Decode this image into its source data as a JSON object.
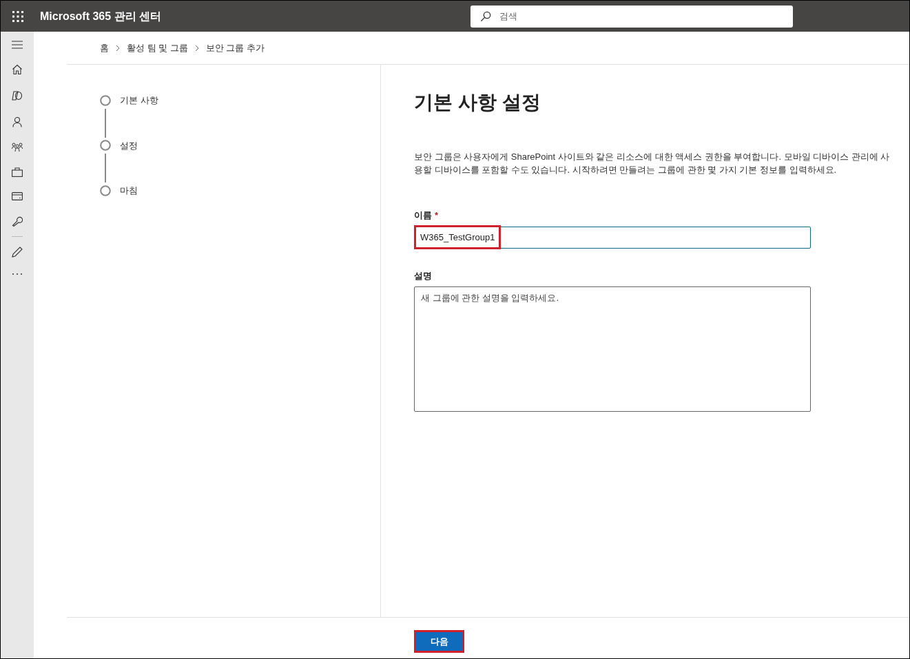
{
  "header": {
    "app_title": "Microsoft 365 관리 센터",
    "search": {
      "placeholder": "검색"
    }
  },
  "breadcrumb": [
    {
      "label": "홈"
    },
    {
      "label": "활성 팀 및 그룹"
    },
    {
      "label": "보안 그룹 추가"
    }
  ],
  "steps": [
    {
      "label": "기본 사항"
    },
    {
      "label": "설정"
    },
    {
      "label": "마침"
    }
  ],
  "main": {
    "title": "기본 사항 설정",
    "description": "보안 그룹은 사용자에게 SharePoint 사이트와 같은 리소스에 대한 액세스 권한을 부여합니다. 모바일 디바이스 관리에 사용할 디바이스를 포함할 수도 있습니다. 시작하려면 만들려는 그룹에 관한 몇 가지 기본 정보를 입력하세요.",
    "name_field": {
      "label": "이름",
      "required_mark": "*",
      "value": "W365_TestGroup1"
    },
    "description_field": {
      "label": "설명",
      "placeholder": "새 그룹에 관한 설명을 입력하세요."
    }
  },
  "footer": {
    "next_button": "다음"
  }
}
